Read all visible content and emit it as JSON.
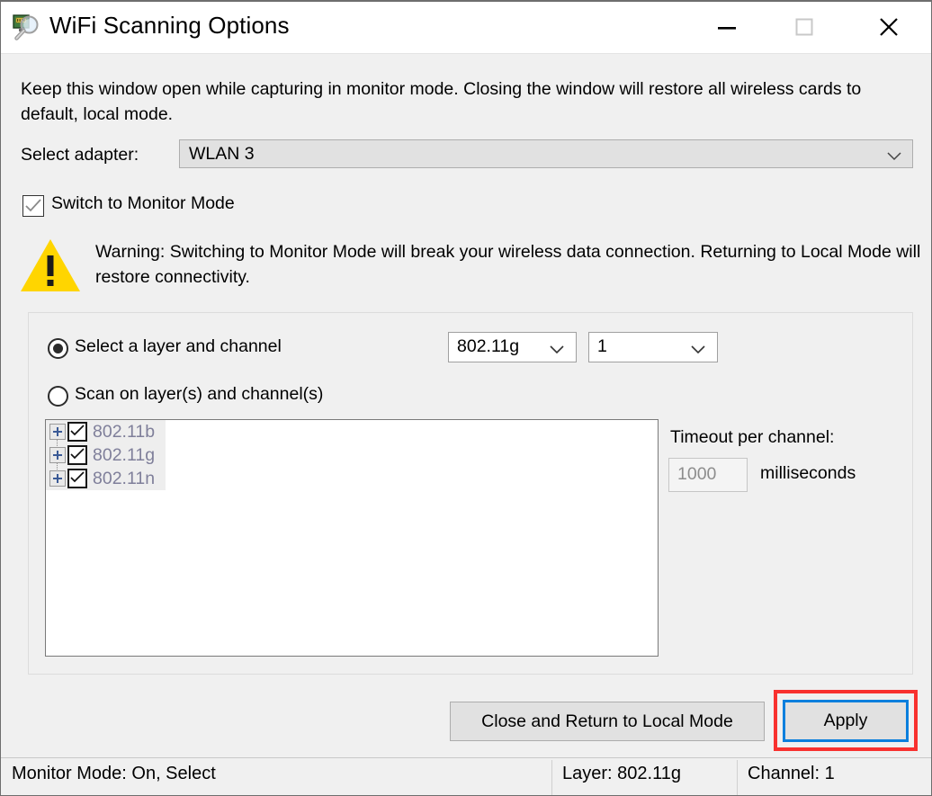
{
  "window": {
    "title": "WiFi Scanning Options",
    "icon": "network-scan-icon",
    "controls": {
      "minimize": "minimize-icon",
      "maximize": "maximize-icon",
      "close": "close-icon"
    }
  },
  "intro": {
    "text": "Keep this window open while capturing in monitor mode. Closing the window will restore all wireless cards to default, local mode."
  },
  "adapter": {
    "label": "Select adapter:",
    "value": "WLAN 3"
  },
  "monitor_mode": {
    "label": "Switch to Monitor Mode",
    "checked": true
  },
  "warning": {
    "icon": "warning-triangle-icon",
    "text": "Warning: Switching to Monitor Mode will break your wireless data connection. Returning to Local Mode will restore connectivity."
  },
  "scan_options": {
    "radio_select_layer": {
      "label": "Select a layer and channel",
      "selected": true
    },
    "radio_scan_layers": {
      "label": "Scan on layer(s) and channel(s)",
      "selected": false
    },
    "layer_combo": {
      "value": "802.11g"
    },
    "channel_combo": {
      "value": "1"
    },
    "tree": [
      {
        "label": "802.11b",
        "checked": true,
        "expander": "plus-icon"
      },
      {
        "label": "802.11g",
        "checked": true,
        "expander": "plus-icon"
      },
      {
        "label": "802.11n",
        "checked": true,
        "expander": "plus-icon"
      }
    ],
    "timeout": {
      "label": "Timeout per channel:",
      "value": "1000",
      "units": "milliseconds"
    }
  },
  "buttons": {
    "close_local": "Close and Return to Local Mode",
    "apply": "Apply"
  },
  "status": {
    "mode": "Monitor Mode: On, Select",
    "layer": "Layer: 802.11g",
    "channel": "Channel: 1"
  },
  "colors": {
    "warning_yellow": "#ffd500",
    "focus_blue": "#0a7fdd",
    "highlight_red": "#f8312f",
    "disabled_text": "#8d8d8d",
    "tree_label": "#7f7f9a"
  }
}
